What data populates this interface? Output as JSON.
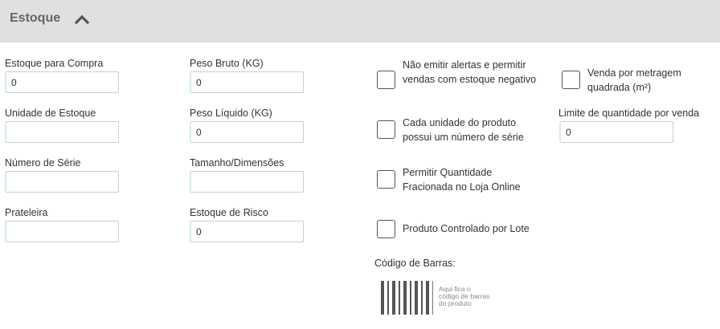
{
  "section": {
    "title": "Estoque",
    "toggle_icon": "chevron-up-icon"
  },
  "col1": {
    "estoque_compra": {
      "label": "Estoque para Compra",
      "value": "0"
    },
    "unidade_estoque": {
      "label": "Unidade de Estoque",
      "value": ""
    },
    "numero_serie": {
      "label": "Número de Série",
      "value": ""
    },
    "prateleira": {
      "label": "Prateleira",
      "value": ""
    }
  },
  "col2": {
    "peso_bruto": {
      "label": "Peso Bruto (KG)",
      "value": "0"
    },
    "peso_liquido": {
      "label": "Peso Líquido (KG)",
      "value": "0"
    },
    "tamanho": {
      "label": "Tamanho/Dimensões",
      "value": ""
    },
    "estoque_risco": {
      "label": "Estoque de Risco",
      "value": "0"
    }
  },
  "col3": {
    "nao_emitir_alertas": {
      "label": "Não emitir alertas e permitir vendas com estoque negativo",
      "checked": false
    },
    "numero_serie_unidade": {
      "label": "Cada unidade do produto possui um número de série",
      "checked": false
    },
    "quantidade_fracionada": {
      "label": "Permitir Quantidade Fracionada no Loja Online",
      "checked": false
    },
    "controlado_lote": {
      "label": "Produto Controlado por Lote",
      "checked": false
    },
    "codigo_barras_label": "Código de Barras:",
    "barcode_placeholder": "Aqui fica o\ncódigo de barras\ndo produto"
  },
  "col4": {
    "venda_metragem": {
      "label": "Venda por metragem quadrada (m²)",
      "checked": false
    },
    "limite_quantidade": {
      "label": "Limite de quantidade por venda",
      "value": "0"
    }
  }
}
